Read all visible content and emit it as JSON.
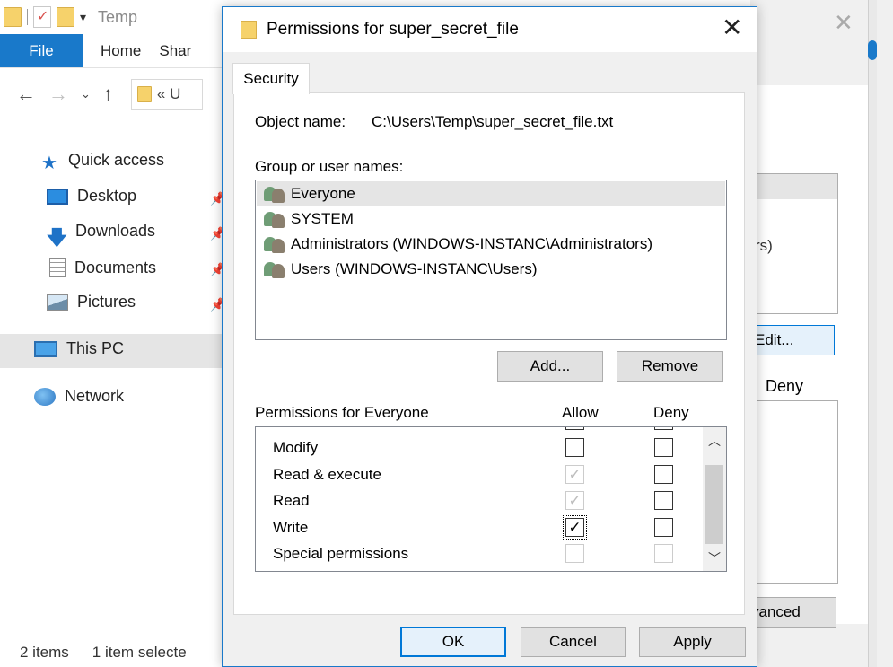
{
  "explorer": {
    "quick_access_title": "Temp",
    "ribbon": {
      "file": "File",
      "tabs": [
        "Home",
        "Shar"
      ]
    },
    "address_fragment": "«  U",
    "nav": {
      "quick_access": "Quick access",
      "desktop": "Desktop",
      "downloads": "Downloads",
      "documents": "Documents",
      "pictures": "Pictures",
      "this_pc": "This PC",
      "network": "Network"
    },
    "status": {
      "items": "2 items",
      "selected": "1 item selecte"
    }
  },
  "props_window": {
    "list_fragment": "rs)",
    "edit_button": "Edit...",
    "deny_header": "Deny",
    "advanced_button": "vanced"
  },
  "dialog": {
    "title": "Permissions for super_secret_file",
    "tab": "Security",
    "object_label": "Object name:",
    "object_value": "C:\\Users\\Temp\\super_secret_file.txt",
    "group_label": "Group or user names:",
    "users": [
      {
        "name": "Everyone",
        "selected": true
      },
      {
        "name": "SYSTEM",
        "selected": false
      },
      {
        "name": "Administrators (WINDOWS-INSTANC\\Administrators)",
        "selected": false
      },
      {
        "name": "Users (WINDOWS-INSTANC\\Users)",
        "selected": false
      }
    ],
    "add_button": "Add...",
    "remove_button": "Remove",
    "permissions_label": "Permissions for Everyone",
    "allow_header": "Allow",
    "deny_header": "Deny",
    "permissions": [
      {
        "name": "Modify",
        "allow": "unchecked",
        "deny": "unchecked"
      },
      {
        "name": "Read & execute",
        "allow": "checked-disabled",
        "deny": "unchecked"
      },
      {
        "name": "Read",
        "allow": "checked-disabled",
        "deny": "unchecked"
      },
      {
        "name": "Write",
        "allow": "checked",
        "deny": "unchecked"
      },
      {
        "name": "Special permissions",
        "allow": "disabled",
        "deny": "disabled"
      }
    ],
    "ok_button": "OK",
    "cancel_button": "Cancel",
    "apply_button": "Apply"
  },
  "colors": {
    "accent": "#1979ca",
    "selection": "#e5e5e5",
    "dialog_bg": "#f0f0f0"
  }
}
